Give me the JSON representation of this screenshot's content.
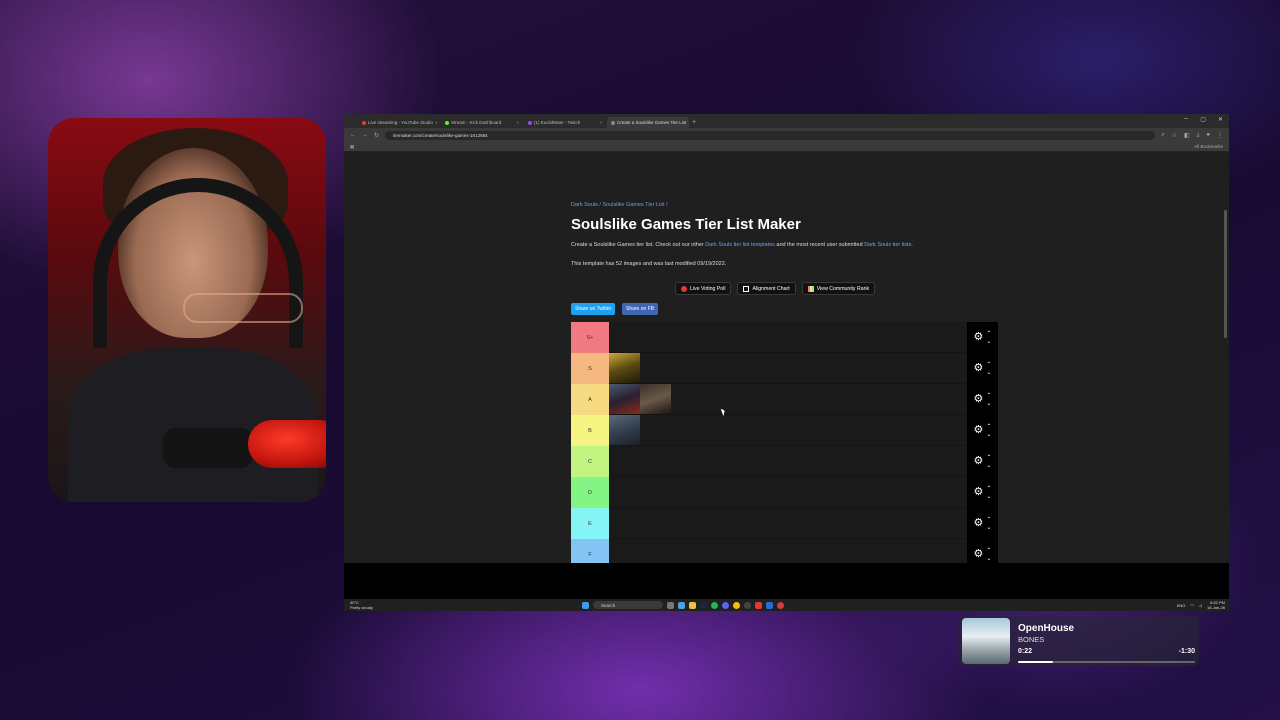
{
  "browser": {
    "tabs": [
      {
        "label": "Live streaming - YouTube Studio",
        "color": "#e53935",
        "active": false
      },
      {
        "label": "Stream - Kick Dashboard",
        "color": "#53fc18",
        "active": false
      },
      {
        "label": "(1) EuclidWaer - Twitch",
        "color": "#9146ff",
        "active": false
      },
      {
        "label": "Create a Soulslike Games Tier List",
        "color": "#888888",
        "active": true
      }
    ],
    "url": "tiermaker.com/create/soulslike-games-1612684",
    "bookmarks_label": "All Bookmarks"
  },
  "page": {
    "breadcrumb": "Dark Souls / Soulslike Games Tier List /",
    "title": "Soulslike Games Tier List Maker",
    "desc_prefix": "Create a Soulslike Games tier list. Check out our other ",
    "desc_link1": "Dark Souls tier list templates",
    "desc_mid": " and the most recent user submitted ",
    "desc_link2": "Dark Souls tier lists",
    "desc_suffix": ".",
    "meta": "This template has 52 images and was last modified 09/19/2022.",
    "buttons": {
      "live_voting": "Live Voting Poll",
      "alignment": "Alignment Chart",
      "community": "View Community Rank"
    },
    "share_twitter": "Share on Twitter",
    "share_fb": "Share on FB"
  },
  "tiers": [
    {
      "label": "S+",
      "color": "#f07a80",
      "items": []
    },
    {
      "label": "S",
      "color": "#f5b880",
      "items": [
        "elden-ring"
      ]
    },
    {
      "label": "A",
      "color": "#f6db82",
      "items": [
        "sekiro",
        "dark-souls"
      ]
    },
    {
      "label": "B",
      "color": "#f6f482",
      "items": [
        "bloodborne"
      ]
    },
    {
      "label": "C",
      "color": "#c2f482",
      "items": []
    },
    {
      "label": "D",
      "color": "#84f484",
      "items": []
    },
    {
      "label": "E",
      "color": "#84f4f4",
      "items": []
    },
    {
      "label": "F",
      "color": "#84c4f4",
      "items": []
    }
  ],
  "now_playing": {
    "title": "OpenHouse",
    "artist": "BONES",
    "elapsed": "0:22",
    "remaining": "-1:30",
    "progress": 0.2
  },
  "taskbar": {
    "weather_temp": "40°C",
    "weather_desc": "Partly cloudy",
    "search_placeholder": "Search",
    "lang": "ENG",
    "time": "6:32 PM",
    "date": "18-Jan-26"
  },
  "colors": {
    "twitter": "#1da1f2",
    "fb": "#4267b2",
    "link": "#6fa6ea"
  }
}
